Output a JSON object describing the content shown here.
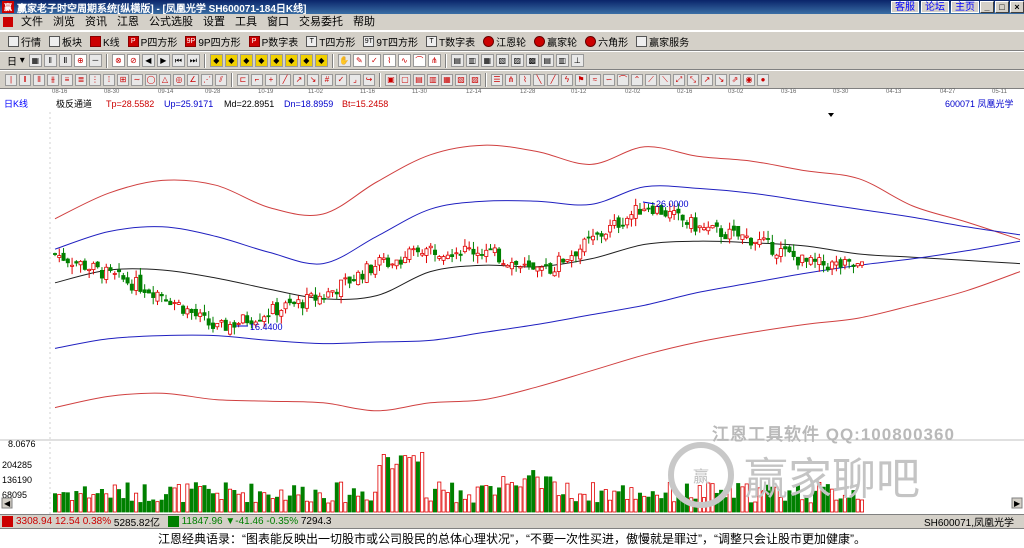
{
  "window": {
    "logo_glyph": "赢",
    "title": "赢家老子时空周期系统[纵横版] - [凤凰光学  SH600071-184日K线]",
    "links": [
      "客服",
      "论坛",
      "主页"
    ],
    "controls": {
      "min": "_",
      "max": "□",
      "close": "×"
    }
  },
  "menu": {
    "items": [
      "文件",
      "浏览",
      "资讯",
      "江恩",
      "公式选股",
      "设置",
      "工具",
      "窗口",
      "交易委托",
      "帮助"
    ]
  },
  "toolbar1": {
    "items": [
      {
        "glyph": "",
        "label": "行情"
      },
      {
        "glyph": "",
        "label": "板块"
      },
      {
        "glyph": "",
        "label": "K线"
      },
      {
        "glyph": "P",
        "label": "P四方形"
      },
      {
        "glyph": "9P",
        "label": "9P四方形"
      },
      {
        "glyph": "P",
        "label": "P数字表"
      },
      {
        "glyph": "T",
        "label": "T四方形"
      },
      {
        "glyph": "9T",
        "label": "9T四方形"
      },
      {
        "glyph": "T",
        "label": "T数字表"
      },
      {
        "glyph": "",
        "label": "江恩轮"
      },
      {
        "glyph": "",
        "label": "赢家轮"
      },
      {
        "glyph": "",
        "label": "六角形"
      },
      {
        "glyph": "",
        "label": "赢家服务"
      }
    ]
  },
  "toolbar2": {
    "period_label": "日",
    "icon_glyphs": [
      "‖",
      "Ⅱ",
      "⊕",
      "⊗",
      "⊘",
      "⊥"
    ]
  },
  "dates": [
    "08-16",
    "08-30",
    "09-14",
    "09-28",
    "10-19",
    "11-02",
    "11-16",
    "11-30",
    "12-14",
    "12-28",
    "01-12",
    "02-02",
    "02-16",
    "03-02",
    "03-16",
    "03-30",
    "04-13",
    "04-27",
    "05-11"
  ],
  "chart_info": {
    "period": "日K线",
    "indicator": "极反通道",
    "tp": "Tp=28.5582",
    "up": "Up=25.9171",
    "md": "Md=22.8951",
    "dn": "Dn=18.8959",
    "bt": "Bt=15.2458",
    "stock": "600071  凤凰光学"
  },
  "annotations": {
    "high_label": "26.0000",
    "low_label": "16.4400"
  },
  "volume": {
    "top_value": "8.0676",
    "ticks": [
      "204285",
      "136190",
      "68095"
    ]
  },
  "watermark": {
    "line1": "江恩工具软件  QQ:100800360",
    "logo_glyph": "赢",
    "line2": "赢家聊吧"
  },
  "status": {
    "sh_index": "3308.94",
    "sh_change": "12.54",
    "sh_pct": "0.38%",
    "sh_amount": "5285.82亿",
    "sz_index": "11847.96",
    "sz_change": "-41.46",
    "sz_pct": "-0.35%",
    "sz_amount": "7294.3",
    "right_text": "SH600071,凤凰光学"
  },
  "quote": "江恩经典语录：“图表能反映出一切股市或公司股民的总体心理状况”，“不要一次性买进，傲慢就是罪过”，“调整只会让股市更加健康”。",
  "chart_data": {
    "type": "candlestick",
    "title": "",
    "x": [
      "08-16",
      "08-30",
      "09-14",
      "09-28",
      "10-19",
      "11-02",
      "11-16",
      "11-30",
      "12-14",
      "12-28",
      "01-12",
      "02-02",
      "02-16",
      "03-02",
      "03-16",
      "03-30",
      "04-13",
      "04-27",
      "05-11"
    ],
    "close_approx": [
      21.5,
      20.2,
      19.0,
      16.8,
      17.9,
      18.9,
      20.9,
      21.8,
      21.7,
      20.2,
      22.4,
      24.6,
      23.1,
      22.4,
      20.9,
      20.7
    ],
    "upper_outer_band_approx": [
      23.7,
      25.3,
      26.1,
      25.8,
      24.4,
      24.0,
      26.0,
      27.7,
      28.3,
      27.9,
      27.1,
      28.2,
      27.6,
      27.3,
      26.7,
      26.2,
      24.5,
      23.5,
      22.4
    ],
    "upper_band_approx": [
      21.8,
      22.9,
      23.2,
      22.6,
      21.6,
      20.9,
      22.6,
      24.3,
      24.8,
      24.8,
      24.6,
      25.7,
      25.6,
      25.3,
      24.8,
      24.3,
      23.8,
      23.2,
      22.7
    ],
    "middle_band_approx": [
      19.7,
      20.5,
      20.5,
      20.0,
      19.3,
      18.7,
      18.9,
      20.4,
      20.8,
      20.7,
      21.2,
      22.1,
      22.3,
      22.2,
      22.0,
      21.5,
      21.3,
      21.1,
      20.9
    ],
    "lower_band_approx": [
      15.6,
      16.2,
      16.4,
      16.4,
      16.1,
      15.9,
      16.0,
      16.1,
      16.6,
      17.1,
      17.7,
      18.3,
      19.1,
      19.7,
      20.3,
      20.8,
      21.2,
      21.7,
      22.3
    ],
    "lower_outer_band_approx": [
      11.9,
      12.6,
      12.8,
      12.4,
      12.3,
      12.2,
      11.7,
      12.2,
      12.4,
      13.2,
      14.2,
      15.2,
      16.0,
      16.6,
      17.1,
      17.5,
      18.3,
      19.2,
      20.4
    ],
    "ylim": [
      10.0,
      30.0
    ],
    "high_marked": 26.0,
    "low_marked": 16.44,
    "volume_ticks": [
      68095,
      136190,
      204285
    ],
    "grid": false
  }
}
